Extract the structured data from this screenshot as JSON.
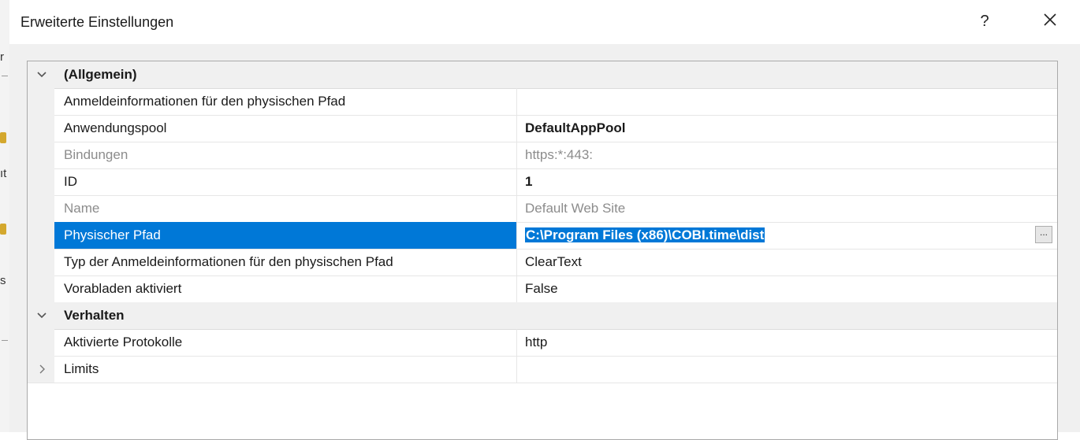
{
  "dialog": {
    "title": "Erweiterte Einstellungen",
    "help_label": "?",
    "close_icon": "close-icon"
  },
  "background_window": {
    "fragments": [
      "r",
      "ıt",
      "s"
    ]
  },
  "categories": [
    {
      "label": "(Allgemein)",
      "expanded": true,
      "properties": [
        {
          "name": "Anmeldeinformationen für den physischen Pfad",
          "value": ""
        },
        {
          "name": "Anwendungspool",
          "value": "DefaultAppPool"
        },
        {
          "name": "Bindungen",
          "value": "https:*:443:"
        },
        {
          "name": "ID",
          "value": "1"
        },
        {
          "name": "Name",
          "value": "Default Web Site"
        },
        {
          "name": "Physischer Pfad",
          "value": "C:\\Program Files (x86)\\COBI.time\\dist",
          "ellipsis": "..."
        },
        {
          "name": "Typ der Anmeldeinformationen für den physischen Pfad",
          "value": "ClearText"
        },
        {
          "name": "Vorabladen aktiviert",
          "value": "False"
        }
      ]
    },
    {
      "label": "Verhalten",
      "expanded": true,
      "properties": [
        {
          "name": "Aktivierte Protokolle",
          "value": "http"
        }
      ]
    },
    {
      "label": "Limits",
      "expanded": false,
      "properties": []
    }
  ],
  "colors": {
    "selection": "#0078d7",
    "grid_gutter": "#f0f0f0",
    "readonly_text": "#8c8c8c"
  }
}
